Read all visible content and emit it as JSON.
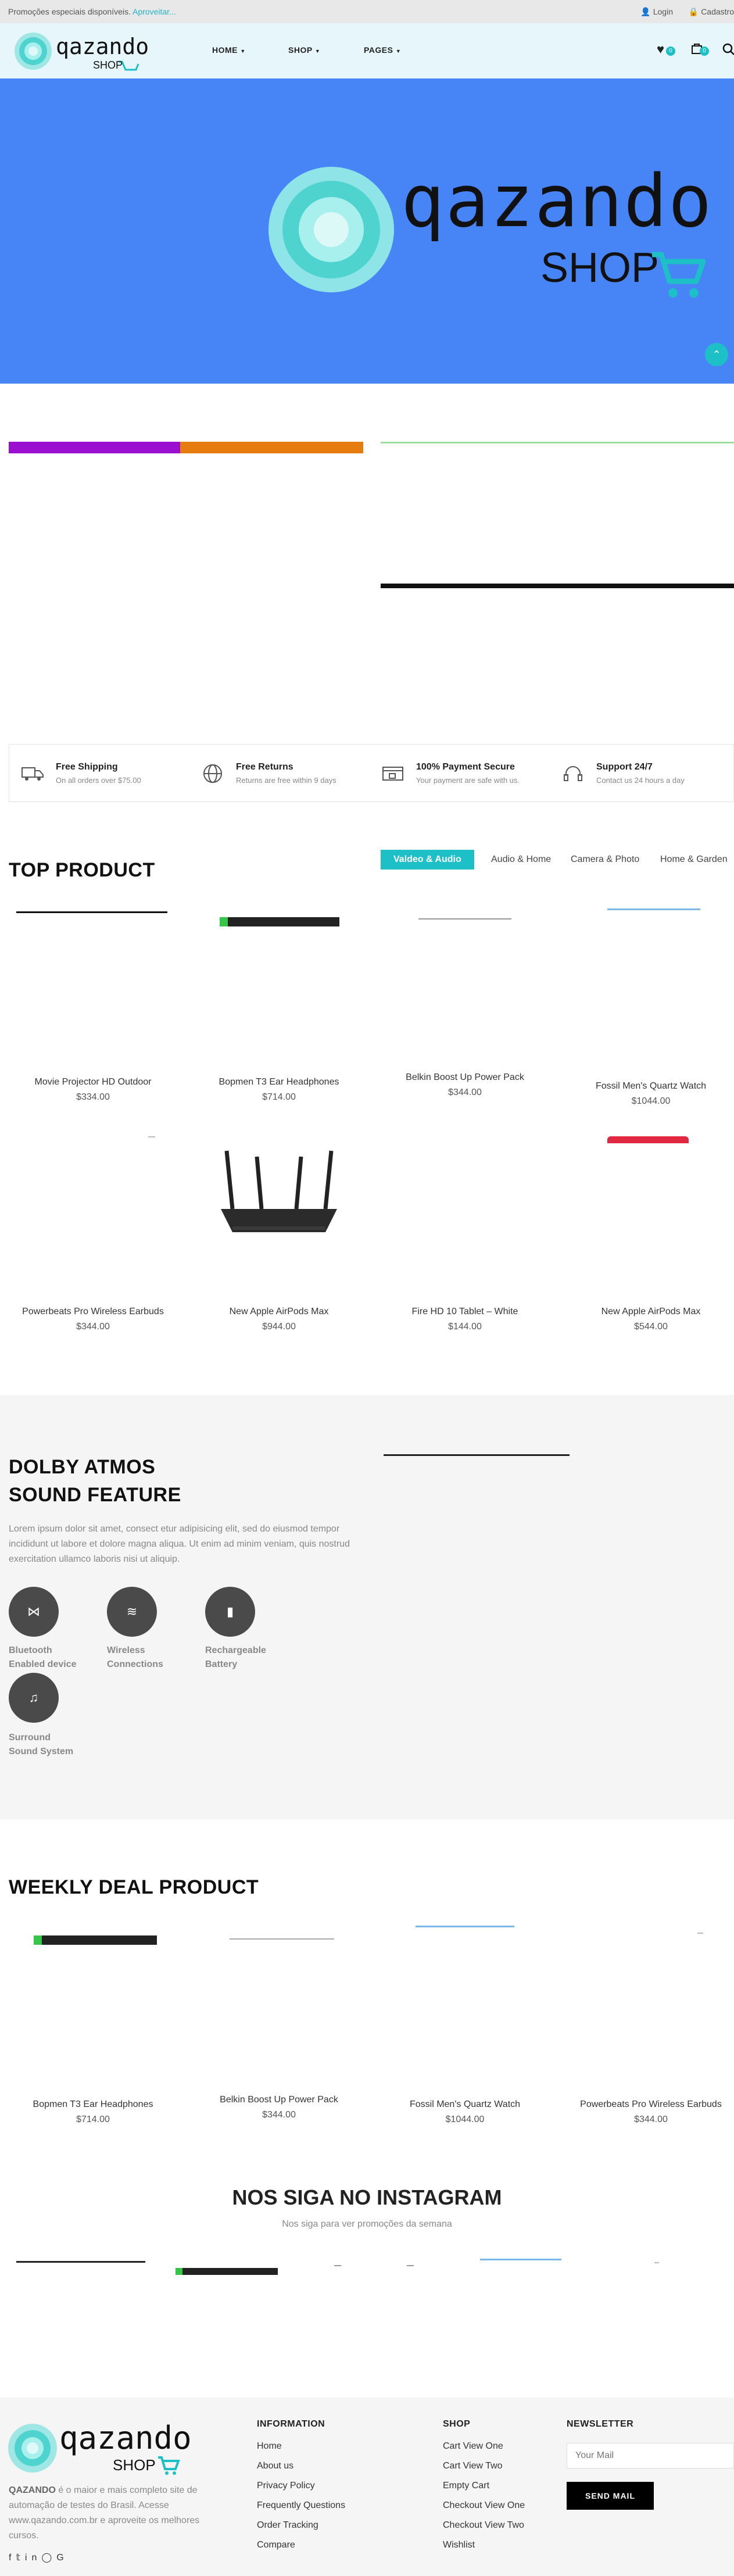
{
  "topbar": {
    "promo": "Promoções especiais disponíveis.",
    "promo_link": "Aproveitar...",
    "login": "Login",
    "signup": "Cadastro"
  },
  "brand": {
    "word": "qazando",
    "sub": "SHOP"
  },
  "nav": {
    "home": "HOME",
    "shop": "SHOP",
    "pages": "PAGES"
  },
  "header_icons": {
    "wishlist_count": "0",
    "cart_count": "0"
  },
  "features": [
    {
      "title": "Free Shipping",
      "desc": "On all orders over $75.00",
      "icon": "truck-icon"
    },
    {
      "title": "Free Returns",
      "desc": "Returns are free within 9 days",
      "icon": "globe-icon"
    },
    {
      "title": "100% Payment Secure",
      "desc": "Your payment are safe with us.",
      "icon": "card-lock-icon"
    },
    {
      "title": "Support 24/7",
      "desc": "Contact us 24 hours a day",
      "icon": "headset-icon"
    }
  ],
  "top_product": {
    "title": "TOP PRODUCT",
    "tabs": [
      "Valdeo & Audio",
      "Audio & Home",
      "Camera & Photo",
      "Home & Garden"
    ],
    "products": [
      {
        "name": "Movie Projector HD Outdoor",
        "price": "$334.00"
      },
      {
        "name": "Bopmen T3 Ear Headphones",
        "price": "$714.00"
      },
      {
        "name": "Belkin Boost Up Power Pack",
        "price": "$344.00"
      },
      {
        "name": "Fossil Men's Quartz Watch",
        "price": "$1044.00"
      },
      {
        "name": "Powerbeats Pro Wireless Earbuds",
        "price": "$344.00"
      },
      {
        "name": "New Apple AirPods Max",
        "price": "$944.00"
      },
      {
        "name": "Fire HD 10 Tablet – White",
        "price": "$144.00"
      },
      {
        "name": "New Apple AirPods Max",
        "price": "$544.00"
      }
    ]
  },
  "dolby": {
    "title_line1": "DOLBY ATMOS",
    "title_line2": "SOUND FEATURE",
    "text": "Lorem ipsum dolor sit amet, consect etur adipisicing elit, sed do eiusmod tempor incididunt ut labore et dolore magna aliqua. Ut enim ad minim veniam, quis nostrud exercitation ullamco laboris nisi ut aliquip.",
    "features": [
      {
        "line1": "Bluetooth",
        "line2": "Enabled device",
        "icon": "bluetooth-icon"
      },
      {
        "line1": "Wireless",
        "line2": "Connections",
        "icon": "wifi-icon"
      },
      {
        "line1": "Rechargeable",
        "line2": "Battery",
        "icon": "battery-icon"
      },
      {
        "line1": "Surround",
        "line2": "Sound System",
        "icon": "speaker-icon"
      }
    ]
  },
  "weekly": {
    "title": "WEEKLY DEAL PRODUCT",
    "products": [
      {
        "name": "Bopmen T3 Ear Headphones",
        "price": "$714.00"
      },
      {
        "name": "Belkin Boost Up Power Pack",
        "price": "$344.00"
      },
      {
        "name": "Fossil Men's Quartz Watch",
        "price": "$1044.00"
      },
      {
        "name": "Powerbeats Pro Wireless Earbuds",
        "price": "$344.00"
      }
    ]
  },
  "instagram": {
    "title": "NOS SIGA NO INSTAGRAM",
    "subtitle": "Nos siga para ver promoções da semana"
  },
  "footer": {
    "about_brand": "QAZANDO",
    "about_text": " é o maior e mais completo site de automação de testes do Brasil. Acesse www.qazando.com.br e aproveite os melhores cursos.",
    "information_title": "INFORMATION",
    "information_links": [
      "Home",
      "About us",
      "Privacy Policy",
      "Frequently Questions",
      "Order Tracking",
      "Compare"
    ],
    "shop_title": "SHOP",
    "shop_links": [
      "Cart View One",
      "Cart View Two",
      "Empty Cart",
      "Checkout View One",
      "Checkout View Two",
      "Wishlist"
    ],
    "newsletter_title": "NEWSLETTER",
    "newsletter_placeholder": "Your Mail",
    "send_label": "SEND MAIL",
    "social_icons": [
      "facebook-icon",
      "twitter-icon",
      "linkedin-icon",
      "instagram-icon",
      "google-icon"
    ]
  },
  "colors": {
    "accent": "#1dc0c7",
    "hero_bg": "#4785f7",
    "purple": "#9b0fd1",
    "orange": "#e67c0f"
  }
}
